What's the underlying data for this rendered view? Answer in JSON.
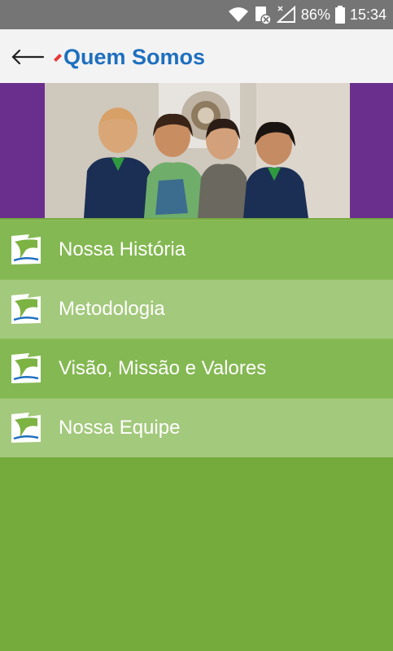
{
  "status": {
    "battery": "86%",
    "time": "15:34",
    "icons": [
      "wifi-icon",
      "notification-muted-icon",
      "signal-icon",
      "battery-icon"
    ]
  },
  "appbar": {
    "title": "Quem Somos",
    "back_icon": "arrow-left-icon"
  },
  "menu": {
    "items": [
      {
        "label": "Nossa História"
      },
      {
        "label": "Metodologia"
      },
      {
        "label": "Visão, Missão e Valores"
      },
      {
        "label": "Nossa Equipe"
      }
    ]
  },
  "colors": {
    "title": "#1e6fbf",
    "appbar_bg": "#f3f3f3",
    "menu_dark": "#84b852",
    "menu_light": "#a3c97c",
    "background": "#76ab40",
    "banner_side": "#6a2f8c"
  }
}
